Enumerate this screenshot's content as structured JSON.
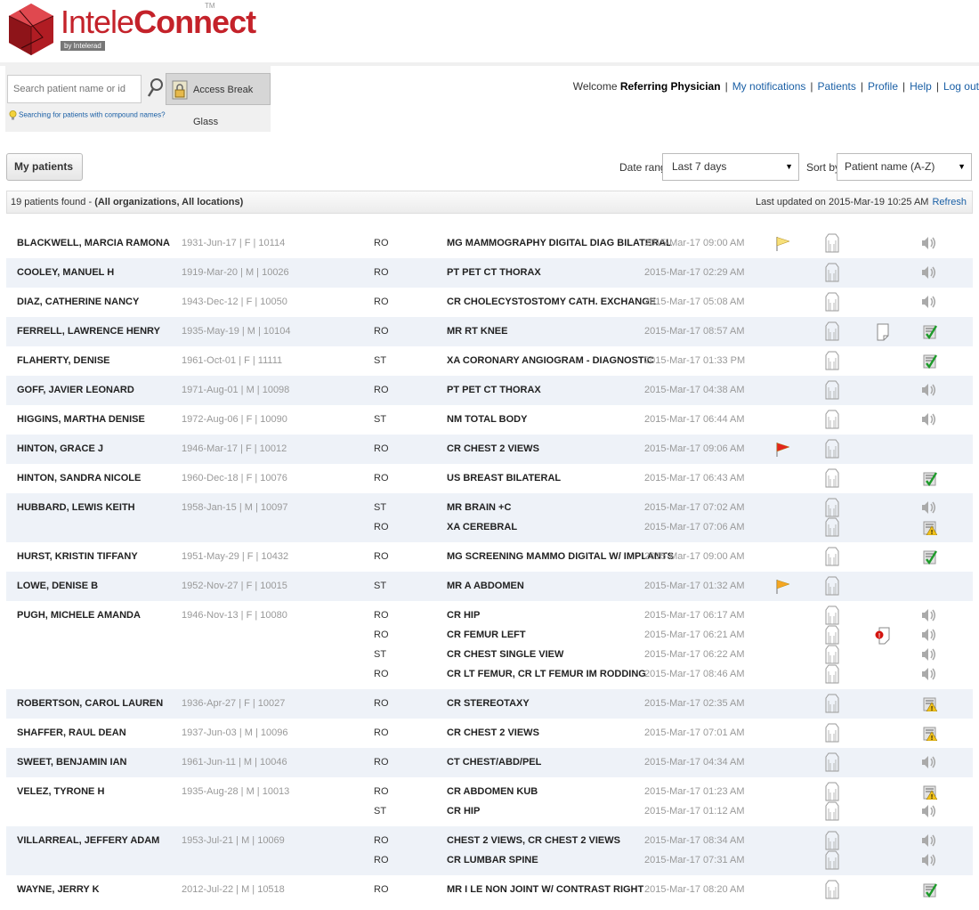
{
  "logo": {
    "prefix": "Intele",
    "suffix": "Connect",
    "tm": "TM",
    "by": "by Intelerad"
  },
  "search": {
    "placeholder": "Search patient name or id",
    "break_glass_label": "Access Break Glass",
    "compound_link": "Searching for patients with compound names?"
  },
  "nav": {
    "welcome": "Welcome",
    "user": "Referring Physician",
    "links": [
      "My notifications",
      "Patients",
      "Profile",
      "Help",
      "Log out"
    ]
  },
  "controls": {
    "my_patients": "My patients",
    "date_range_label": "Date range",
    "date_range_value": "Last 7 days",
    "sort_label": "Sort by",
    "sort_value": "Patient name (A-Z)"
  },
  "info": {
    "count_text": "19 patients found - ",
    "scope": "(All organizations, All locations)",
    "last_updated": "Last updated on 2015-Mar-19 10:25 AM",
    "refresh": "Refresh"
  },
  "colors": {
    "accent": "#c4222a",
    "link": "#1a5fa5",
    "row_alt": "#eef2f8"
  },
  "patients": [
    {
      "name": "BLACKWELL, MARCIA RAMONA",
      "info": "1931-Jun-17 | F | 10114",
      "exams": [
        {
          "status": "RO",
          "desc": "MG MAMMOGRAPHY DIGITAL DIAG BILATERAL",
          "date": "2015-Mar-17 09:00 AM",
          "flag": "yellow",
          "doc": "",
          "report": "audio"
        }
      ]
    },
    {
      "name": "COOLEY, MANUEL H",
      "info": "1919-Mar-20 | M | 10026",
      "exams": [
        {
          "status": "RO",
          "desc": "PT PET CT THORAX",
          "date": "2015-Mar-17 02:29 AM",
          "flag": "",
          "doc": "",
          "report": "audio"
        }
      ]
    },
    {
      "name": "DIAZ, CATHERINE NANCY",
      "info": "1943-Dec-12 | F | 10050",
      "exams": [
        {
          "status": "RO",
          "desc": "CR CHOLECYSTOSTOMY CATH. EXCHANGE",
          "date": "2015-Mar-17 05:08 AM",
          "flag": "",
          "doc": "",
          "report": "audio"
        }
      ]
    },
    {
      "name": "FERRELL, LAWRENCE HENRY",
      "info": "1935-May-19 | M | 10104",
      "exams": [
        {
          "status": "RO",
          "desc": "MR RT KNEE",
          "date": "2015-Mar-17 08:57 AM",
          "flag": "",
          "doc": "plain",
          "report": "final"
        }
      ]
    },
    {
      "name": "FLAHERTY, DENISE",
      "info": "1961-Oct-01 | F | 11111",
      "exams": [
        {
          "status": "ST",
          "desc": "XA CORONARY ANGIOGRAM - DIAGNOSTIC",
          "date": "2015-Mar-17 01:33 PM",
          "flag": "",
          "doc": "",
          "report": "final"
        }
      ]
    },
    {
      "name": "GOFF, JAVIER LEONARD",
      "info": "1971-Aug-01 | M | 10098",
      "exams": [
        {
          "status": "RO",
          "desc": "PT PET CT THORAX",
          "date": "2015-Mar-17 04:38 AM",
          "flag": "",
          "doc": "",
          "report": "audio"
        }
      ]
    },
    {
      "name": "HIGGINS, MARTHA DENISE",
      "info": "1972-Aug-06 | F | 10090",
      "exams": [
        {
          "status": "ST",
          "desc": "NM TOTAL BODY",
          "date": "2015-Mar-17 06:44 AM",
          "flag": "",
          "doc": "",
          "report": "audio"
        }
      ]
    },
    {
      "name": "HINTON, GRACE J",
      "info": "1946-Mar-17 | F | 10012",
      "exams": [
        {
          "status": "RO",
          "desc": "CR CHEST 2 VIEWS",
          "date": "2015-Mar-17 09:06 AM",
          "flag": "red",
          "doc": "",
          "report": ""
        }
      ]
    },
    {
      "name": "HINTON, SANDRA NICOLE",
      "info": "1960-Dec-18 | F | 10076",
      "exams": [
        {
          "status": "RO",
          "desc": "US BREAST BILATERAL",
          "date": "2015-Mar-17 06:43 AM",
          "flag": "",
          "doc": "",
          "report": "final"
        }
      ]
    },
    {
      "name": "HUBBARD, LEWIS KEITH",
      "info": "1958-Jan-15 | M | 10097",
      "exams": [
        {
          "status": "ST",
          "desc": "MR BRAIN +C",
          "date": "2015-Mar-17 07:02 AM",
          "flag": "",
          "doc": "",
          "report": "audio"
        },
        {
          "status": "RO",
          "desc": "XA CEREBRAL",
          "date": "2015-Mar-17 07:06 AM",
          "flag": "",
          "doc": "",
          "report": "prelim"
        }
      ]
    },
    {
      "name": "HURST, KRISTIN TIFFANY",
      "info": "1951-May-29 | F | 10432",
      "exams": [
        {
          "status": "RO",
          "desc": "MG SCREENING MAMMO DIGITAL W/ IMPLANTS",
          "date": "2015-Mar-17 09:00 AM",
          "flag": "",
          "doc": "",
          "report": "final"
        }
      ]
    },
    {
      "name": "LOWE, DENISE B",
      "info": "1952-Nov-27 | F | 10015",
      "exams": [
        {
          "status": "ST",
          "desc": "MR A ABDOMEN",
          "date": "2015-Mar-17 01:32 AM",
          "flag": "orange",
          "doc": "",
          "report": ""
        }
      ]
    },
    {
      "name": "PUGH, MICHELE AMANDA",
      "info": "1946-Nov-13 | F | 10080",
      "exams": [
        {
          "status": "RO",
          "desc": "CR HIP",
          "date": "2015-Mar-17 06:17 AM",
          "flag": "",
          "doc": "",
          "report": "audio"
        },
        {
          "status": "RO",
          "desc": "CR FEMUR LEFT",
          "date": "2015-Mar-17 06:21 AM",
          "flag": "",
          "doc": "alert",
          "report": "audio"
        },
        {
          "status": "ST",
          "desc": "CR CHEST SINGLE VIEW",
          "date": "2015-Mar-17 06:22 AM",
          "flag": "",
          "doc": "",
          "report": "audio"
        },
        {
          "status": "RO",
          "desc": "CR LT FEMUR, CR LT FEMUR IM RODDING",
          "date": "2015-Mar-17 08:46 AM",
          "flag": "",
          "doc": "",
          "report": "audio"
        }
      ]
    },
    {
      "name": "ROBERTSON, CAROL LAUREN",
      "info": "1936-Apr-27 | F | 10027",
      "exams": [
        {
          "status": "RO",
          "desc": "CR STEREOTAXY",
          "date": "2015-Mar-17 02:35 AM",
          "flag": "",
          "doc": "",
          "report": "prelim"
        }
      ]
    },
    {
      "name": "SHAFFER, RAUL DEAN",
      "info": "1937-Jun-03 | M | 10096",
      "exams": [
        {
          "status": "RO",
          "desc": "CR CHEST 2 VIEWS",
          "date": "2015-Mar-17 07:01 AM",
          "flag": "",
          "doc": "",
          "report": "prelim"
        }
      ]
    },
    {
      "name": "SWEET, BENJAMIN IAN",
      "info": "1961-Jun-11 | M | 10046",
      "exams": [
        {
          "status": "RO",
          "desc": "CT CHEST/ABD/PEL",
          "date": "2015-Mar-17 04:34 AM",
          "flag": "",
          "doc": "",
          "report": "audio"
        }
      ]
    },
    {
      "name": "VELEZ, TYRONE H",
      "info": "1935-Aug-28 | M | 10013",
      "exams": [
        {
          "status": "RO",
          "desc": "CR ABDOMEN KUB",
          "date": "2015-Mar-17 01:23 AM",
          "flag": "",
          "doc": "",
          "report": "prelim"
        },
        {
          "status": "ST",
          "desc": "CR HIP",
          "date": "2015-Mar-17 01:12 AM",
          "flag": "",
          "doc": "",
          "report": "audio"
        }
      ]
    },
    {
      "name": "VILLARREAL, JEFFERY ADAM",
      "info": "1953-Jul-21 | M | 10069",
      "exams": [
        {
          "status": "RO",
          "desc": "CHEST 2 VIEWS, CR CHEST 2 VIEWS",
          "date": "2015-Mar-17 08:34 AM",
          "flag": "",
          "doc": "",
          "report": "audio"
        },
        {
          "status": "RO",
          "desc": "CR LUMBAR SPINE",
          "date": "2015-Mar-17 07:31 AM",
          "flag": "",
          "doc": "",
          "report": "audio"
        }
      ]
    },
    {
      "name": "WAYNE, JERRY K",
      "info": "2012-Jul-22 | M | 10518",
      "exams": [
        {
          "status": "RO",
          "desc": "MR I LE NON JOINT W/ CONTRAST RIGHT",
          "date": "2015-Mar-17 08:20 AM",
          "flag": "",
          "doc": "",
          "report": "final"
        }
      ]
    }
  ]
}
